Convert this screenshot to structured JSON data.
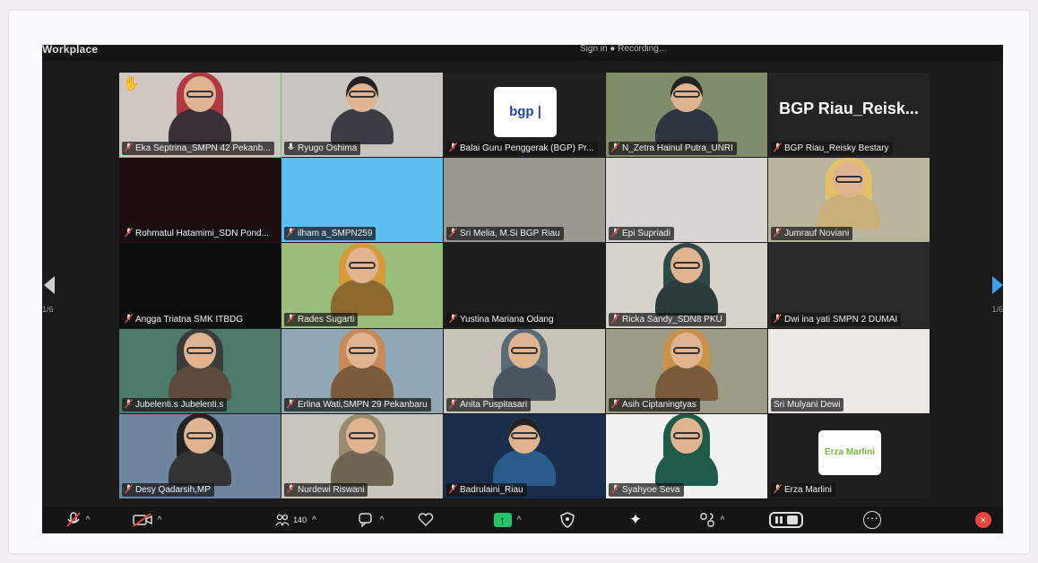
{
  "window": {
    "title": "Workplace",
    "top_info": "Sign in  ●  Recording…"
  },
  "tiles": [
    {
      "name": "Eka Septrina_SMPN 42 Pekanb...",
      "bg": "#cfc7c2",
      "kind": "hijab",
      "hijab": "#b03a44",
      "body": "#3b2f3a",
      "mic": "hand"
    },
    {
      "name": "Ryugo Oshima",
      "bg": "#c9c5c0",
      "kind": "man",
      "body": "#3c3d44",
      "mic": "unmuted"
    },
    {
      "name": "Balai Guru Penggerak (BGP) Pr...",
      "bg": "#1f1f1f",
      "kind": "logo",
      "logo": "bgp | Riau",
      "mic": "muted"
    },
    {
      "name": "N_Zetra Hainul Putra_UNRI",
      "bg": "#7f8c6a",
      "kind": "man",
      "body": "#2f3540",
      "mic": "muted"
    },
    {
      "name": "BGP Riau_Reisky Bestary",
      "bg": "#242424",
      "kind": "text",
      "big": "BGP  Riau_Reisk...",
      "mic": "muted"
    },
    {
      "name": "Rohmatul Hatamimi_SDN Pond...",
      "bg": "#1f0d0d",
      "kind": "none",
      "mic": "muted"
    },
    {
      "name": "ilham a_SMPN259",
      "bg": "#5bbdf0",
      "kind": "none",
      "mic": "muted"
    },
    {
      "name": "Sri Melia, M.Si BGP Riau",
      "bg": "#9c9790",
      "kind": "none",
      "mic": "muted"
    },
    {
      "name": "Epi Supriadi",
      "bg": "#d8d6d2",
      "kind": "none",
      "mic": "muted"
    },
    {
      "name": "Jumrauf Noviani",
      "bg": "#b9b49d",
      "kind": "hijab",
      "hijab": "#e2c06a",
      "body": "#c9b07a",
      "mic": "muted"
    },
    {
      "name": "Angga Triatna SMK ITBDG",
      "bg": "#0c0c0c",
      "kind": "none",
      "mic": "muted"
    },
    {
      "name": "Rades Sugarti",
      "bg": "#9bbd7c",
      "kind": "hijab",
      "hijab": "#d59b3b",
      "body": "#8c6a2d",
      "mic": "muted"
    },
    {
      "name": "Yustina Mariana Odang",
      "bg": "#1e1e1e",
      "kind": "none",
      "mic": "muted"
    },
    {
      "name": "Ricka Sandy_SDN8 PKU",
      "bg": "#d7d2ca",
      "kind": "hijab",
      "hijab": "#304a4a",
      "body": "#2c3b3b",
      "mic": "muted"
    },
    {
      "name": "Dwi ina yati SMPN 2 DUMAI",
      "bg": "#2a2a2a",
      "kind": "none",
      "mic": "muted"
    },
    {
      "name": "Jubelenti.s Jubelenti.s",
      "bg": "#4d7a6a",
      "kind": "hijab",
      "hijab": "#3b3b3b",
      "body": "#5c4a3c",
      "mic": "muted"
    },
    {
      "name": "Erlina Wati,SMPN 29 Pekanbaru",
      "bg": "#8fa8b3",
      "kind": "hijab",
      "hijab": "#c88a5a",
      "body": "#7a5a3a",
      "mic": "muted"
    },
    {
      "name": "Anita Puspitasari",
      "bg": "#c9c4ba",
      "kind": "hijab",
      "hijab": "#5a6b78",
      "body": "#4a5560",
      "mic": "muted"
    },
    {
      "name": "Asih Ciptaningtyas",
      "bg": "#9d9a86",
      "kind": "hijab",
      "hijab": "#c9924a",
      "body": "#7a5a3a",
      "mic": "muted"
    },
    {
      "name": "Sri Mulyani Dewi",
      "bg": "#ece9e4",
      "kind": "none",
      "mic": "none"
    },
    {
      "name": "Desy Qadarsih,MP",
      "bg": "#6f86a0",
      "kind": "hijab",
      "hijab": "#222",
      "body": "#333",
      "mic": "muted"
    },
    {
      "name": "Nurdewi Riswani",
      "bg": "#c8c6bd",
      "kind": "hijab",
      "hijab": "#9a8a70",
      "body": "#6f6553",
      "mic": "muted"
    },
    {
      "name": "Badrulaini_Riau",
      "bg": "#1a2d4a",
      "kind": "man",
      "body": "#2b5b8a",
      "mic": "muted"
    },
    {
      "name": "Syahyoe Seva",
      "bg": "#f1f1ef",
      "kind": "hijab",
      "hijab": "#1f5a4a",
      "body": "#1f5a4a",
      "mic": "muted"
    },
    {
      "name": "Erza Marlini",
      "bg": "#1f1f1f",
      "kind": "erza",
      "logo": "Erza Marlini",
      "mic": "muted"
    }
  ],
  "nav": {
    "left_page": "1/6",
    "right_page": "1/6"
  },
  "toolbar": {
    "participants_count": "140",
    "accent": "#23c26b",
    "close_color": "#e8463a"
  }
}
